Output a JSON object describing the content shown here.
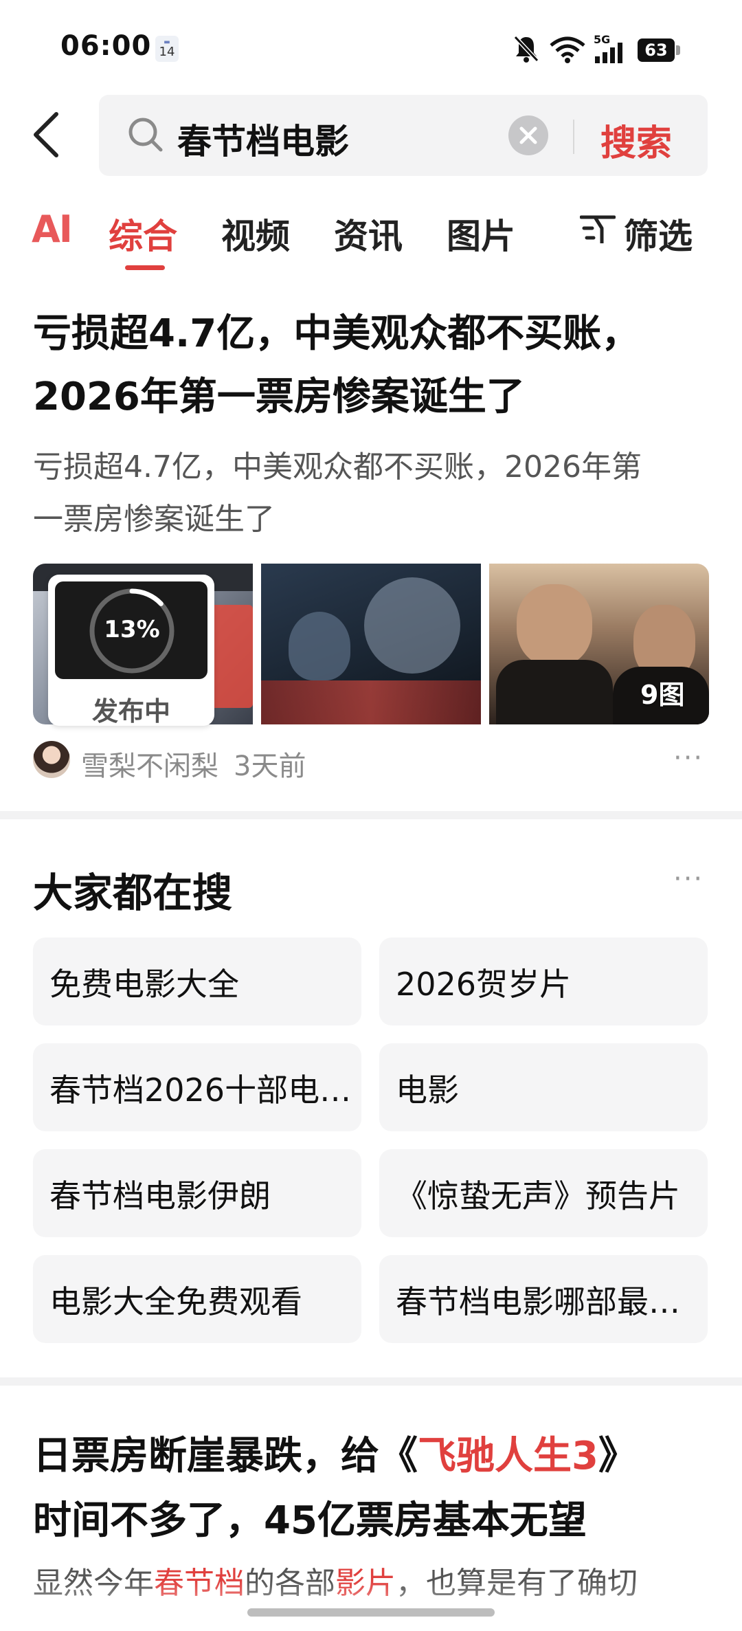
{
  "status_bar": {
    "time": "06:00",
    "calendar_badge": "14",
    "network": "5G",
    "battery": "63"
  },
  "search": {
    "query": "春节档电影",
    "button_label": "搜索"
  },
  "tabs": {
    "ai": "AI",
    "items": [
      "综合",
      "视频",
      "资讯",
      "图片"
    ],
    "active": "综合",
    "filter_label": "筛选"
  },
  "article1": {
    "title_line1": "亏损超4.7亿，中美观众都不买账，",
    "title_line2": "2026年第一票房惨案诞生了",
    "desc_line1": "亏损超4.7亿，中美观众都不买账，2026年第",
    "desc_line2": "一票房惨案诞生了",
    "upload_progress": "13%",
    "upload_status": "发布中",
    "image_count": "9图",
    "author": "雪梨不闲梨",
    "time_ago": "3天前"
  },
  "everyone_searches": {
    "title": "大家都在搜",
    "items": [
      "免费电影大全",
      "2026贺岁片",
      "春节档2026十部电…",
      "电影",
      "春节档电影伊朗",
      "《惊蛰无声》预告片",
      "电影大全免费观看",
      "春节档电影哪部最…"
    ]
  },
  "article2": {
    "title_prefix": "日票房断崖暴跌，给《",
    "title_highlight": "飞驰人生3",
    "title_suffix": "》",
    "title_line2": "时间不多了，45亿票房基本无望",
    "snippet_part1": "显然今年",
    "snippet_hl1": "春节档",
    "snippet_part2": "的各部",
    "snippet_hl2": "影片",
    "snippet_part3": "，也算是有了确切"
  },
  "colors": {
    "accent": "#e0403e",
    "muted": "#8a8a8a",
    "chip_bg": "#f5f5f6"
  }
}
